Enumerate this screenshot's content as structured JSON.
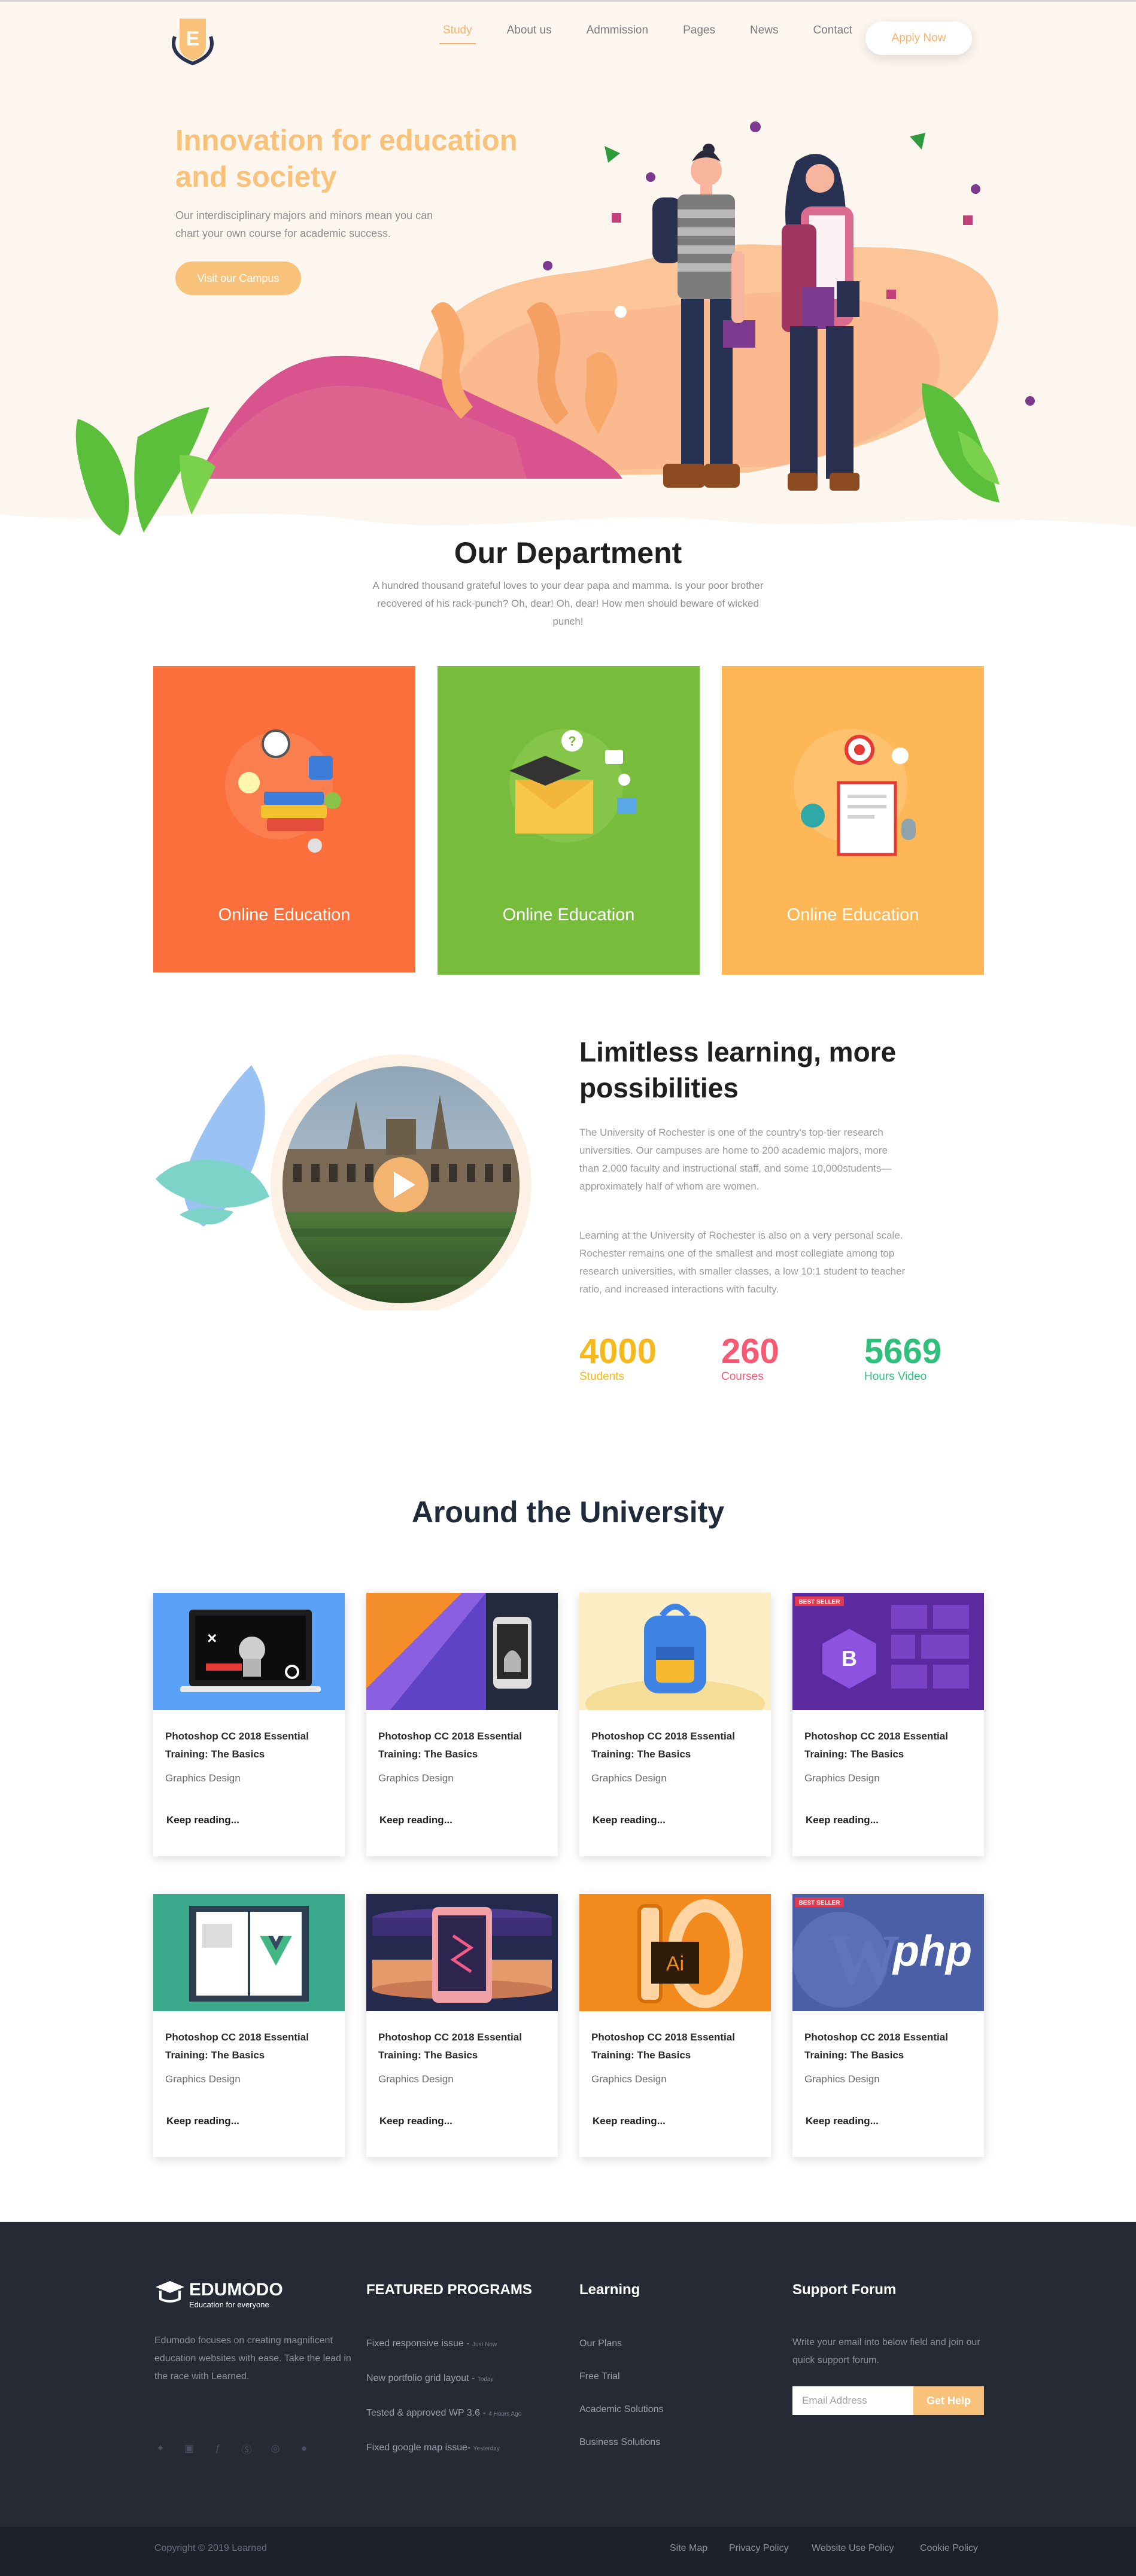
{
  "nav": {
    "items": [
      {
        "label": "Study",
        "active": true
      },
      {
        "label": "About us",
        "active": false
      },
      {
        "label": "Admmission",
        "active": false
      },
      {
        "label": "Pages",
        "active": false
      },
      {
        "label": "News",
        "active": false
      },
      {
        "label": "Contact",
        "active": false
      }
    ],
    "apply_label": "Apply Now",
    "logo_letter": "E"
  },
  "hero": {
    "title": "Innovation for education and society",
    "description": "Our interdisciplinary majors and minors mean you can chart your own course for academic success.",
    "cta": "Visit our Campus"
  },
  "department": {
    "title": "Our Department",
    "description": "A hundred thousand grateful loves to your dear papa and mamma. Is your poor brother recovered of his rack-punch? Oh, dear! Oh, dear! How men should beware of wicked punch!",
    "cards": [
      {
        "label": "Online Education",
        "color": "#fa6f3b"
      },
      {
        "label": "Online Education",
        "color": "#78bc3b"
      },
      {
        "label": "Online Education",
        "color": "#feb757"
      }
    ]
  },
  "limitless": {
    "title": "Limitless learning, more possibilities",
    "paragraphs": [
      "The University of Rochester is one of the country's top-tier research universities. Our campuses are home to 200 academic majors, more than 2,000 faculty and instructional staff, and some 10,000students—approximately half of whom are women.",
      "Learning at the University of Rochester is also on a very personal scale. Rochester remains one of the smallest and most collegiate among top research universities, with smaller classes, a low 10:1 student to teacher ratio, and increased interactions with faculty."
    ],
    "stats": [
      {
        "value": "4000",
        "label": "Students",
        "color": "#f7b81b"
      },
      {
        "value": "260",
        "label": "Courses",
        "color": "#f75a73"
      },
      {
        "value": "5669",
        "label": "Hours Video",
        "color": "#2ec07a"
      }
    ]
  },
  "around": {
    "title": "Around the University",
    "courses": [
      {
        "title": "Photoshop CC 2018 Essential Training: The Basics",
        "category": "Graphics Design",
        "link": "Keep reading...",
        "image": "laptop-video"
      },
      {
        "title": "Photoshop CC 2018 Essential Training: The Basics",
        "category": "Graphics Design",
        "link": "Keep reading...",
        "image": "android-kotlin"
      },
      {
        "title": "Photoshop CC 2018 Essential Training: The Basics",
        "category": "Graphics Design",
        "link": "Keep reading...",
        "image": "backpack"
      },
      {
        "title": "Photoshop CC 2018 Essential Training: The Basics",
        "category": "Graphics Design",
        "link": "Keep reading...",
        "image": "bootstrap",
        "badge": "BEST SELLER"
      },
      {
        "title": "Photoshop CC 2018 Essential Training: The Basics",
        "category": "Graphics Design",
        "link": "Keep reading...",
        "image": "vue-book"
      },
      {
        "title": "Photoshop CC 2018 Essential Training: The Basics",
        "category": "Graphics Design",
        "link": "Keep reading...",
        "image": "tablet-stack"
      },
      {
        "title": "Photoshop CC 2018 Essential Training: The Basics",
        "category": "Graphics Design",
        "link": "Keep reading...",
        "image": "illustrator-10"
      },
      {
        "title": "Photoshop CC 2018 Essential Training: The Basics",
        "category": "Graphics Design",
        "link": "Keep reading...",
        "image": "php",
        "badge": "BEST SELLER"
      }
    ]
  },
  "footer": {
    "brand": "EDUMODO",
    "tagline": "Education for everyone",
    "about": "Edumodo focuses on creating magnificent education websites with ease. Take the lead in the race with Learned.",
    "featured_title": "FEATURED PROGRAMS",
    "featured": [
      {
        "label": "Fixed responsive issue -",
        "time": "Just Now"
      },
      {
        "label": "New portfolio grid layout -",
        "time": "Today"
      },
      {
        "label": "Tested & approved WP 3.6 -",
        "time": "4 Hours Ago"
      },
      {
        "label": "Fixed google map issue-",
        "time": "Yesterday"
      }
    ],
    "learning_title": "Learning",
    "learning": [
      "Our Plans",
      "Free Trial",
      "Academic Solutions",
      "Business Solutions"
    ],
    "support_title": "Support Forum",
    "support_text": "Write your email into below field and join our quick support forum.",
    "email_placeholder": "Email Address",
    "help_label": "Get Help",
    "social_icons": [
      "twitter-icon",
      "linkedin-icon",
      "facebook-icon",
      "skype-icon",
      "dribbble-icon",
      "apple-icon"
    ],
    "copyright": "Copyright © 2019 Learned",
    "legal": [
      "Site Map",
      "Privacy Policy",
      "Website Use Policy",
      "Cookie Policy"
    ]
  }
}
